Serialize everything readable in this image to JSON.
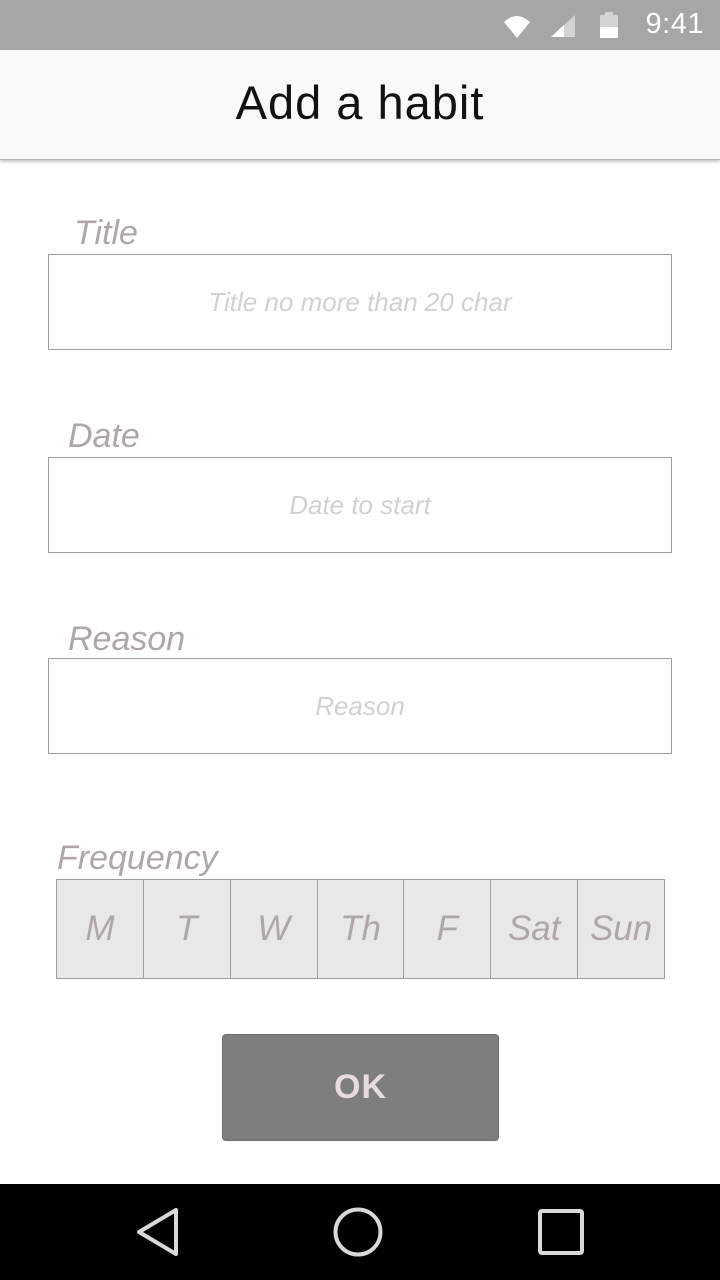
{
  "status_bar": {
    "time": "9:41",
    "icons": [
      "wifi-icon",
      "cell-signal-icon",
      "battery-icon"
    ]
  },
  "app_bar": {
    "title": "Add a habit"
  },
  "form": {
    "title": {
      "label": "Title",
      "placeholder": "Title no more than 20 char",
      "value": ""
    },
    "date": {
      "label": "Date",
      "placeholder": "Date to start",
      "value": ""
    },
    "reason": {
      "label": "Reason",
      "placeholder": "Reason",
      "value": ""
    },
    "frequency": {
      "label": "Frequency",
      "days": [
        "M",
        "T",
        "W",
        "Th",
        "F",
        "Sat",
        "Sun"
      ]
    },
    "ok_label": "OK"
  },
  "nav_bar": {
    "buttons": [
      "back-icon",
      "home-icon",
      "recents-icon"
    ]
  },
  "colors": {
    "status_bar": "#a6a6a6",
    "app_bar": "#f9f9f9",
    "label_text": "#aea7aa",
    "placeholder_text": "#d3d0d1",
    "day_cell_bg": "#e8e8e8",
    "ok_button_bg": "#7e7e7e",
    "ok_button_text": "#e6dcdf",
    "nav_bar": "#000000"
  }
}
